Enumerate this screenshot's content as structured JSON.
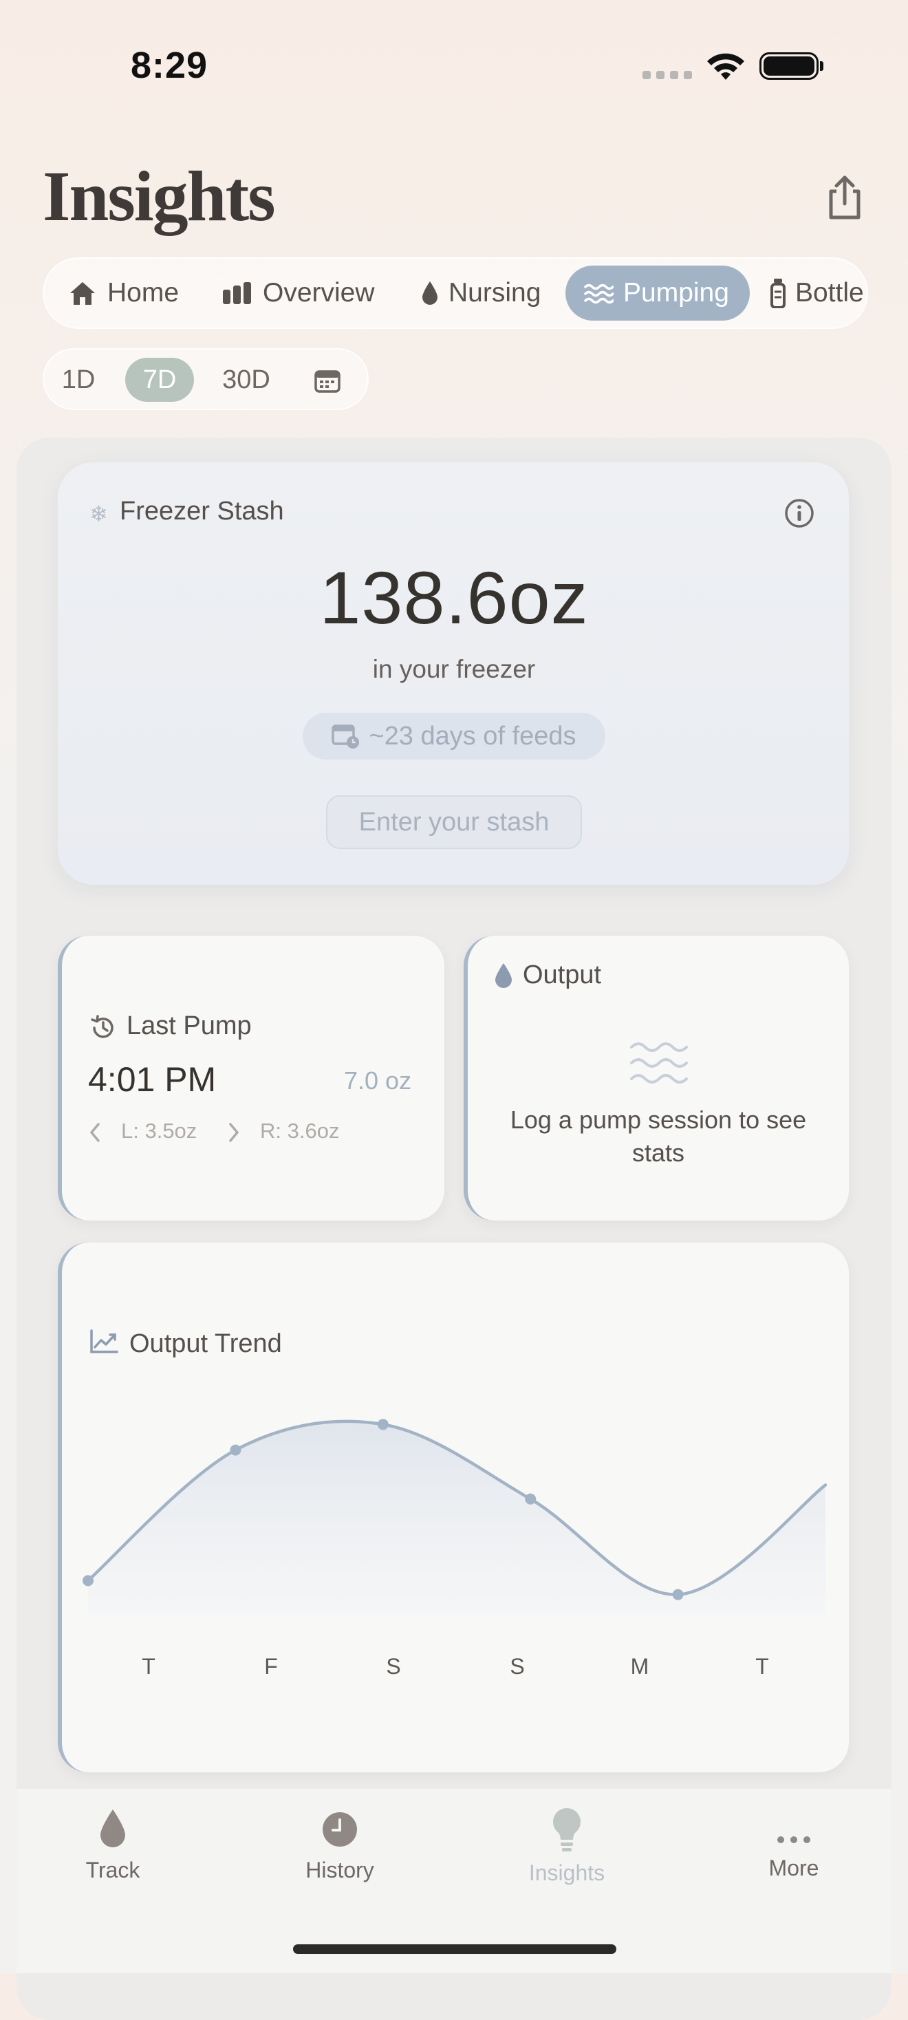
{
  "status_bar": {
    "time": "8:29"
  },
  "header": {
    "title": "Insights"
  },
  "tabs": [
    {
      "label": "Home",
      "icon": "home-icon"
    },
    {
      "label": "Overview",
      "icon": "bar-chart-icon"
    },
    {
      "label": "Nursing",
      "icon": "drop-icon"
    },
    {
      "label": "Pumping",
      "icon": "waves-icon",
      "active": true
    },
    {
      "label": "Bottle",
      "icon": "bottle-icon"
    }
  ],
  "ranges": [
    {
      "label": "1D"
    },
    {
      "label": "7D",
      "active": true
    },
    {
      "label": "30D"
    }
  ],
  "freezer": {
    "label": "Freezer Stash",
    "amount": "138.6oz",
    "subtitle": "in your freezer",
    "days_badge": "~23 days of feeds",
    "button": "Enter your stash"
  },
  "last_pump": {
    "label": "Last Pump",
    "time": "4:01 PM",
    "amount": "7.0 oz",
    "left": "L: 3.5oz",
    "right": "R: 3.6oz"
  },
  "output": {
    "label": "Output",
    "message": "Log a pump session to see stats"
  },
  "trend": {
    "label": "Output Trend"
  },
  "chart_data": {
    "type": "line",
    "categories": [
      "T",
      "F",
      "S",
      "S",
      "M",
      "T"
    ],
    "values": [
      1.2,
      6.8,
      7.9,
      4.7,
      0.6,
      5.3
    ],
    "title": "Output Trend",
    "xlabel": "",
    "ylabel": ""
  },
  "bottom_nav": [
    {
      "label": "Track",
      "icon": "drop-icon"
    },
    {
      "label": "History",
      "icon": "clock-icon"
    },
    {
      "label": "Insights",
      "icon": "lightbulb-icon",
      "active": true
    },
    {
      "label": "More",
      "icon": "more-icon"
    }
  ],
  "colors": {
    "accent": "#a3b3c6",
    "range_active": "#b7c4be",
    "card_border": "#a9b8c9"
  }
}
